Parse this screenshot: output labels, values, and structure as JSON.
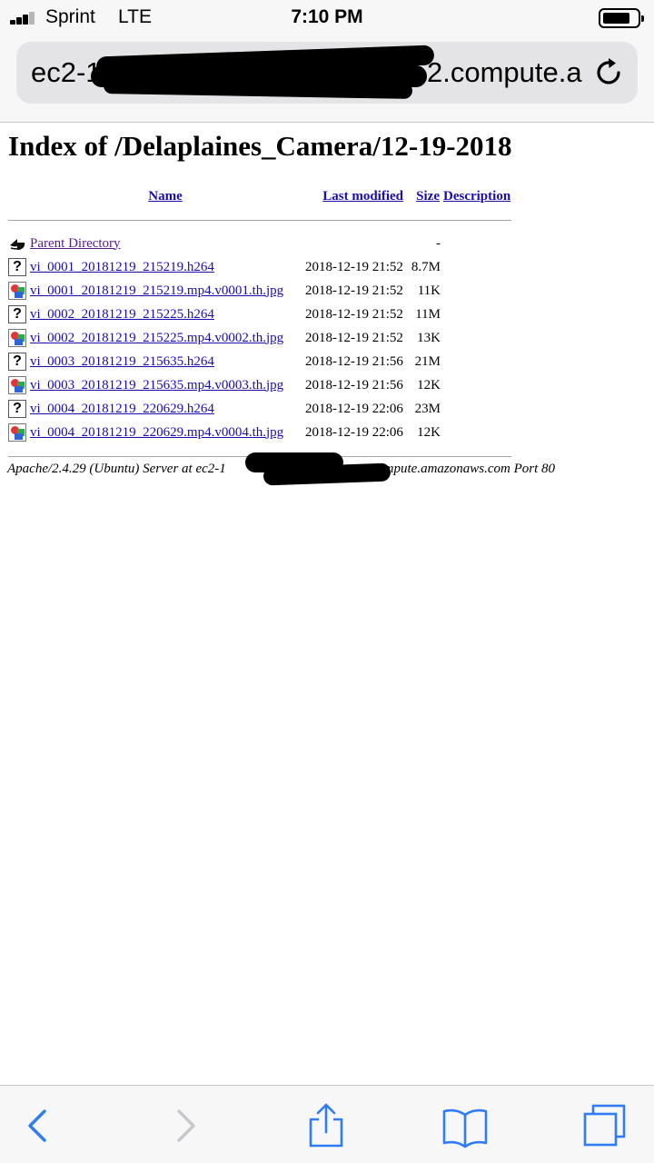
{
  "status_bar": {
    "carrier": "Sprint",
    "network": "LTE",
    "time": "7:10 PM",
    "icons": [
      "signal-icon",
      "battery-icon"
    ]
  },
  "url_bar": {
    "url_visible_start": "ec2-1",
    "url_visible_end": "2.compute.a",
    "reload_icon": "reload-icon"
  },
  "page": {
    "title": "Index of /Delaplaines_Camera/12-19-2018",
    "columns": {
      "name": "Name",
      "last_modified": "Last modified",
      "size": "Size",
      "description": "Description"
    },
    "parent": {
      "label": "Parent Directory",
      "size": "-",
      "icon": "back-icon"
    },
    "files": [
      {
        "name": "vi_0001_20181219_215219.h264",
        "modified": "2018-12-19 21:52",
        "size": "8.7M",
        "icon": "unknown-file-icon"
      },
      {
        "name": "vi_0001_20181219_215219.mp4.v0001.th.jpg",
        "modified": "2018-12-19 21:52",
        "size": "11K",
        "icon": "image-file-icon"
      },
      {
        "name": "vi_0002_20181219_215225.h264",
        "modified": "2018-12-19 21:52",
        "size": "11M",
        "icon": "unknown-file-icon"
      },
      {
        "name": "vi_0002_20181219_215225.mp4.v0002.th.jpg",
        "modified": "2018-12-19 21:52",
        "size": "13K",
        "icon": "image-file-icon"
      },
      {
        "name": "vi_0003_20181219_215635.h264",
        "modified": "2018-12-19 21:56",
        "size": "21M",
        "icon": "unknown-file-icon"
      },
      {
        "name": "vi_0003_20181219_215635.mp4.v0003.th.jpg",
        "modified": "2018-12-19 21:56",
        "size": "12K",
        "icon": "image-file-icon"
      },
      {
        "name": "vi_0004_20181219_220629.h264",
        "modified": "2018-12-19 22:06",
        "size": "23M",
        "icon": "unknown-file-icon"
      },
      {
        "name": "vi_0004_20181219_220629.mp4.v0004.th.jpg",
        "modified": "2018-12-19 22:06",
        "size": "12K",
        "icon": "image-file-icon"
      }
    ],
    "footer_start": "Apache/2.4.29 (Ubuntu) Server at ec2-1",
    "footer_end": "ust-2.compute.amazonaws.com Port 80"
  },
  "toolbar": {
    "icons": [
      "back-arrow-icon",
      "forward-arrow-icon",
      "share-icon",
      "bookmarks-icon",
      "tabs-icon"
    ]
  }
}
